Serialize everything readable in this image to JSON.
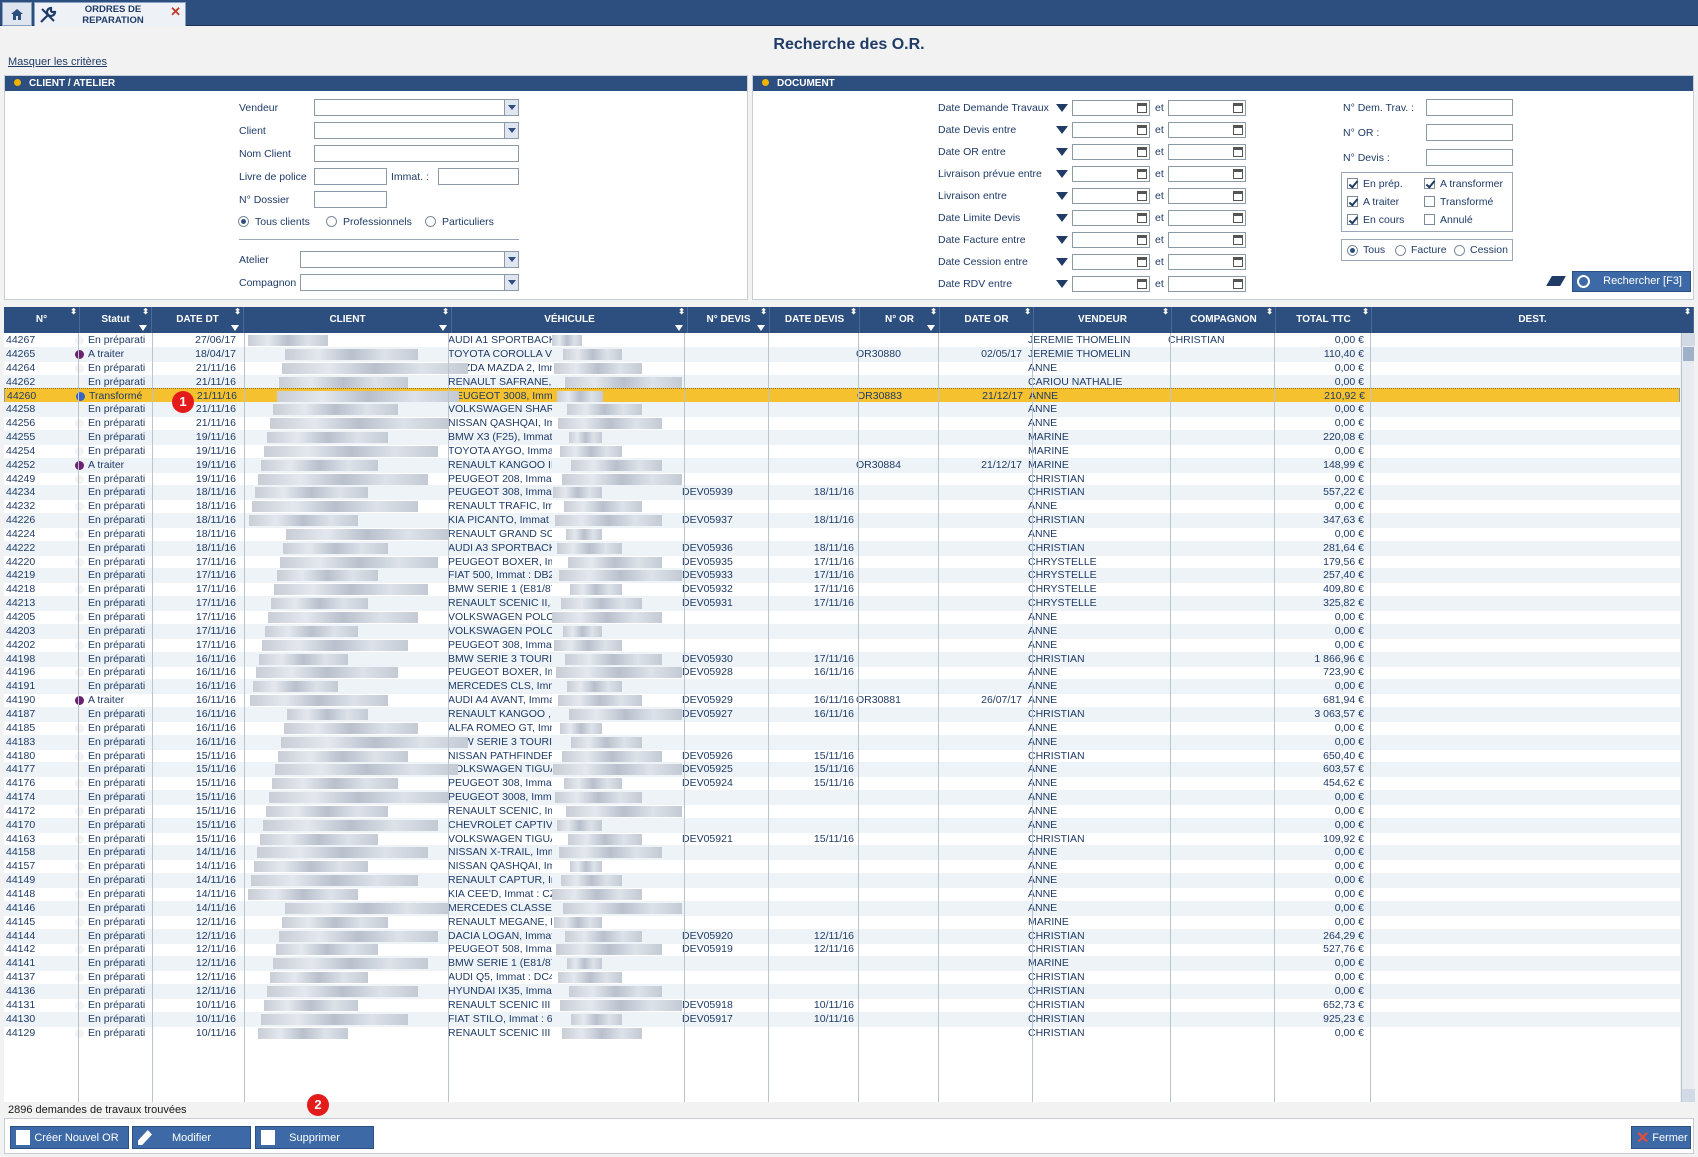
{
  "tabs": {
    "home_icon": "home-icon",
    "tool_icon": "wrench-screwdriver-icon",
    "tab_title_line1": "ORDRES DE",
    "tab_title_line2": "REPARATION",
    "close": "✕"
  },
  "page": {
    "title": "Recherche des O.R.",
    "mask_link": "Masquer les critères"
  },
  "client_panel": {
    "title": "CLIENT / ATELIER",
    "vendeur": "Vendeur",
    "client": "Client",
    "nom_client": "Nom Client",
    "livre_police": "Livre de police",
    "immat": "Immat. :",
    "dossier": "N° Dossier",
    "radio_tous": "Tous clients",
    "radio_pro": "Professionnels",
    "radio_part": "Particuliers",
    "atelier": "Atelier",
    "compagnon": "Compagnon"
  },
  "doc_panel": {
    "title": "DOCUMENT",
    "dates": [
      "Date Demande Travaux",
      "Date Devis entre",
      "Date OR entre",
      "Livraison prévue entre",
      "Livraison entre",
      "Date Limite Devis",
      "Date Facture entre",
      "Date Cession entre",
      "Date RDV entre"
    ],
    "et": "et",
    "dem_trav": "N° Dem. Trav. :",
    "n_or": "N° OR :",
    "n_devis": "N° Devis :",
    "chk_en_prep": "En prép.",
    "chk_a_transformer": "A transformer",
    "chk_a_traiter": "A traiter",
    "chk_transforme": "Transformé",
    "chk_en_cours": "En cours",
    "chk_annule": "Annulé",
    "r_tous": "Tous",
    "r_facture": "Facture",
    "r_cession": "Cession",
    "search_btn": "Rechercher [F3]"
  },
  "grid": {
    "headers": [
      "N°",
      "Statut",
      "DATE DT",
      "CLIENT",
      "VÉHICULE",
      "N° DEVIS",
      "DATE DEVIS",
      "N° OR",
      "DATE OR",
      "VENDEUR",
      "COMPAGNON",
      "TOTAL TTC",
      "DEST."
    ],
    "rows": [
      [
        "44267",
        "En préparati",
        "27/06/17",
        "AUDI A1 SPORTBACK",
        "",
        "",
        "",
        "",
        "JEREMIE THOMELIN",
        "CHRISTIAN",
        "0,00 €"
      ],
      [
        "44265",
        "A traiter",
        "18/04/17",
        "TOYOTA COROLLA V",
        "",
        "",
        "OR30880",
        "02/05/17",
        "JEREMIE THOMELIN",
        "",
        "110,40 €"
      ],
      [
        "44264",
        "En préparati",
        "21/11/16",
        "MAZDA MAZDA 2, Imm",
        "",
        "",
        "",
        "",
        "ANNE",
        "",
        "0,00 €"
      ],
      [
        "44262",
        "En préparati",
        "21/11/16",
        "RENAULT SAFRANE,",
        "",
        "",
        "",
        "",
        "CARIOU NATHALIE",
        "",
        "0,00 €"
      ],
      [
        "44260",
        "Transformé",
        "21/11/16",
        "PEUGEOT 3008, Imma",
        "",
        "",
        "OR30883",
        "21/12/17",
        "ANNE",
        "",
        "210,92 €"
      ],
      [
        "44258",
        "En préparati",
        "21/11/16",
        "VOLKSWAGEN SHAR",
        "",
        "",
        "",
        "",
        "ANNE",
        "",
        "0,00 €"
      ],
      [
        "44256",
        "En préparati",
        "21/11/16",
        "NISSAN QASHQAI, Im",
        "",
        "",
        "",
        "",
        "ANNE",
        "",
        "0,00 €"
      ],
      [
        "44255",
        "En préparati",
        "19/11/16",
        "BMW X3 (F25), Immat :",
        "",
        "",
        "",
        "",
        "MARINE",
        "",
        "220,08 €"
      ],
      [
        "44254",
        "En préparati",
        "19/11/16",
        "TOYOTA AYGO, Imma",
        "",
        "",
        "",
        "",
        "MARINE",
        "",
        "0,00 €"
      ],
      [
        "44252",
        "A traiter",
        "19/11/16",
        "RENAULT KANGOO II",
        "",
        "",
        "OR30884",
        "21/12/17",
        "MARINE",
        "",
        "148,99 €"
      ],
      [
        "44249",
        "En préparati",
        "19/11/16",
        "PEUGEOT 208, Immat",
        "",
        "",
        "",
        "",
        "CHRISTIAN",
        "",
        "0,00 €"
      ],
      [
        "44234",
        "En préparati",
        "18/11/16",
        "PEUGEOT 308, Immat",
        "DEV05939",
        "18/11/16",
        "",
        "",
        "CHRISTIAN",
        "",
        "557,22 €"
      ],
      [
        "44232",
        "En préparati",
        "18/11/16",
        "RENAULT TRAFIC, Im",
        "",
        "",
        "",
        "",
        "ANNE",
        "",
        "0,00 €"
      ],
      [
        "44226",
        "En préparati",
        "18/11/16",
        "KIA PICANTO, Immat :",
        "DEV05937",
        "18/11/16",
        "",
        "",
        "CHRISTIAN",
        "",
        "347,63 €"
      ],
      [
        "44224",
        "En préparati",
        "18/11/16",
        "RENAULT GRAND SC",
        "",
        "",
        "",
        "",
        "ANNE",
        "",
        "0,00 €"
      ],
      [
        "44222",
        "En préparati",
        "18/11/16",
        "AUDI A3 SPORTBACK",
        "DEV05936",
        "18/11/16",
        "",
        "",
        "CHRISTIAN",
        "",
        "281,64 €"
      ],
      [
        "44220",
        "En préparati",
        "17/11/16",
        "PEUGEOT BOXER, Im",
        "DEV05935",
        "17/11/16",
        "",
        "",
        "CHRYSTELLE",
        "",
        "179,56 €"
      ],
      [
        "44219",
        "En préparati",
        "17/11/16",
        "FIAT 500, Immat : DB2",
        "DEV05933",
        "17/11/16",
        "",
        "",
        "CHRYSTELLE",
        "",
        "257,40 €"
      ],
      [
        "44218",
        "En préparati",
        "17/11/16",
        "BMW SERIE 1 (E81/87",
        "DEV05932",
        "17/11/16",
        "",
        "",
        "CHRYSTELLE",
        "",
        "409,80 €"
      ],
      [
        "44213",
        "En préparati",
        "17/11/16",
        "RENAULT SCENIC II,",
        "DEV05931",
        "17/11/16",
        "",
        "",
        "CHRYSTELLE",
        "",
        "325,82 €"
      ],
      [
        "44205",
        "En préparati",
        "17/11/16",
        "VOLKSWAGEN POLO",
        "",
        "",
        "",
        "",
        "ANNE",
        "",
        "0,00 €"
      ],
      [
        "44203",
        "En préparati",
        "17/11/16",
        "VOLKSWAGEN POLO",
        "",
        "",
        "",
        "",
        "ANNE",
        "",
        "0,00 €"
      ],
      [
        "44202",
        "En préparati",
        "17/11/16",
        "PEUGEOT 308, Immat",
        "",
        "",
        "",
        "",
        "ANNE",
        "",
        "0,00 €"
      ],
      [
        "44198",
        "En préparati",
        "16/11/16",
        "BMW SERIE 3 TOURI",
        "DEV05930",
        "17/11/16",
        "",
        "",
        "CHRISTIAN",
        "",
        "1 866,96 €"
      ],
      [
        "44196",
        "En préparati",
        "16/11/16",
        "PEUGEOT BOXER, Im",
        "DEV05928",
        "16/11/16",
        "",
        "",
        "ANNE",
        "",
        "723,90 €"
      ],
      [
        "44191",
        "En préparati",
        "16/11/16",
        "MERCEDES CLS, Imm",
        "",
        "",
        "",
        "",
        "ANNE",
        "",
        "0,00 €"
      ],
      [
        "44190",
        "A traiter",
        "16/11/16",
        "AUDI A4 AVANT, Imma",
        "DEV05929",
        "16/11/16",
        "OR30881",
        "26/07/17",
        "ANNE",
        "",
        "681,94 €"
      ],
      [
        "44187",
        "En préparati",
        "16/11/16",
        "RENAULT KANGOO ,",
        "DEV05927",
        "16/11/16",
        "",
        "",
        "CHRISTIAN",
        "",
        "3 063,57 €"
      ],
      [
        "44185",
        "En préparati",
        "16/11/16",
        "ALFA ROMEO GT, Imm",
        "",
        "",
        "",
        "",
        "ANNE",
        "",
        "0,00 €"
      ],
      [
        "44183",
        "En préparati",
        "16/11/16",
        "BMW SERIE 3 TOURI",
        "",
        "",
        "",
        "",
        "ANNE",
        "",
        "0,00 €"
      ],
      [
        "44180",
        "En préparati",
        "15/11/16",
        "NISSAN PATHFINDER",
        "DEV05926",
        "15/11/16",
        "",
        "",
        "CHRISTIAN",
        "",
        "650,40 €"
      ],
      [
        "44177",
        "En préparati",
        "15/11/16",
        "VOLKSWAGEN TIGUA",
        "DEV05925",
        "15/11/16",
        "",
        "",
        "ANNE",
        "",
        "603,57 €"
      ],
      [
        "44176",
        "En préparati",
        "15/11/16",
        "PEUGEOT 308, Immat",
        "DEV05924",
        "15/11/16",
        "",
        "",
        "ANNE",
        "",
        "454,62 €"
      ],
      [
        "44174",
        "En préparati",
        "15/11/16",
        "PEUGEOT 3008, Imma",
        "",
        "",
        "",
        "",
        "ANNE",
        "",
        "0,00 €"
      ],
      [
        "44172",
        "En préparati",
        "15/11/16",
        "RENAULT SCENIC, Im",
        "",
        "",
        "",
        "",
        "ANNE",
        "",
        "0,00 €"
      ],
      [
        "44170",
        "En préparati",
        "15/11/16",
        "CHEVROLET CAPTIVA",
        "",
        "",
        "",
        "",
        "ANNE",
        "",
        "0,00 €"
      ],
      [
        "44163",
        "En préparati",
        "15/11/16",
        "VOLKSWAGEN TIGUA",
        "DEV05921",
        "15/11/16",
        "",
        "",
        "CHRISTIAN",
        "",
        "109,92 €"
      ],
      [
        "44158",
        "En préparati",
        "14/11/16",
        "NISSAN X-TRAIL, Imm",
        "",
        "",
        "",
        "",
        "ANNE",
        "",
        "0,00 €"
      ],
      [
        "44157",
        "En préparati",
        "14/11/16",
        "NISSAN QASHQAI, Im",
        "",
        "",
        "",
        "",
        "ANNE",
        "",
        "0,00 €"
      ],
      [
        "44149",
        "En préparati",
        "14/11/16",
        "RENAULT CAPTUR, Ir",
        "",
        "",
        "",
        "",
        "ANNE",
        "",
        "0,00 €"
      ],
      [
        "44148",
        "En préparati",
        "14/11/16",
        "KIA CEE'D, Immat : CZ",
        "",
        "",
        "",
        "",
        "ANNE",
        "",
        "0,00 €"
      ],
      [
        "44146",
        "En préparati",
        "14/11/16",
        "MERCEDES CLASSE I",
        "",
        "",
        "",
        "",
        "ANNE",
        "",
        "0,00 €"
      ],
      [
        "44145",
        "En préparati",
        "12/11/16",
        "RENAULT MEGANE, I",
        "",
        "",
        "",
        "",
        "MARINE",
        "",
        "0,00 €"
      ],
      [
        "44144",
        "En préparati",
        "12/11/16",
        "DACIA LOGAN, Immat",
        "DEV05920",
        "12/11/16",
        "",
        "",
        "CHRISTIAN",
        "",
        "264,29 €"
      ],
      [
        "44142",
        "En préparati",
        "12/11/16",
        "PEUGEOT 508, Immat",
        "DEV05919",
        "12/11/16",
        "",
        "",
        "CHRISTIAN",
        "",
        "527,76 €"
      ],
      [
        "44141",
        "En préparati",
        "12/11/16",
        "BMW SERIE 1 (E81/87",
        "",
        "",
        "",
        "",
        "MARINE",
        "",
        "0,00 €"
      ],
      [
        "44137",
        "En préparati",
        "12/11/16",
        "AUDI Q5, Immat : DC4",
        "",
        "",
        "",
        "",
        "CHRISTIAN",
        "",
        "0,00 €"
      ],
      [
        "44136",
        "En préparati",
        "12/11/16",
        "HYUNDAI IX35, Immat",
        "",
        "",
        "",
        "",
        "CHRISTIAN",
        "",
        "0,00 €"
      ],
      [
        "44131",
        "En préparati",
        "10/11/16",
        "RENAULT SCENIC III",
        "DEV05918",
        "10/11/16",
        "",
        "",
        "CHRISTIAN",
        "",
        "652,73 €"
      ],
      [
        "44130",
        "En préparati",
        "10/11/16",
        "FIAT STILO, Immat : 6",
        "DEV05917",
        "10/11/16",
        "",
        "",
        "CHRISTIAN",
        "",
        "925,23 €"
      ],
      [
        "44129",
        "En préparati",
        "10/11/16",
        "RENAULT SCENIC III",
        "",
        "",
        "",
        "",
        "CHRISTIAN",
        "",
        "0,00 €"
      ]
    ],
    "selected_index": 4,
    "status_colors": {
      "A traiter": "#6b2170",
      "Transformé": "#3a64c2",
      "En préparati": "#f3f3f3"
    }
  },
  "footer": {
    "count": "2896 demandes de travaux trouvées"
  },
  "buttons": {
    "create": "Créer Nouvel OR",
    "modify": "Modifier",
    "delete": "Supprimer",
    "close": "Fermer"
  },
  "annotations": {
    "one": "1",
    "two": "2"
  }
}
